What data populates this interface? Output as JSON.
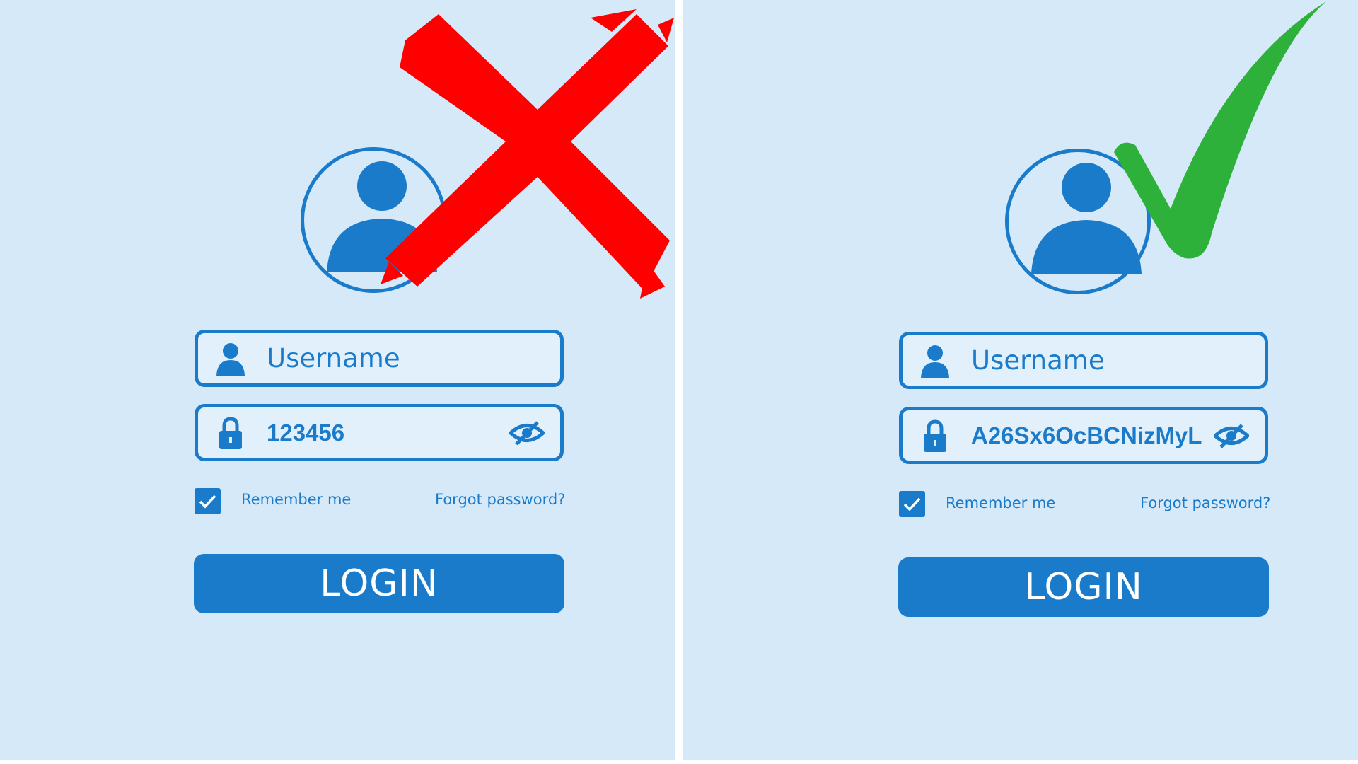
{
  "colors": {
    "background": "#d6e9f8",
    "accent": "#1a7bcb",
    "cross_mark": "#ff0000",
    "check_mark": "#2eb13a"
  },
  "left_panel": {
    "avatar_icon": "user-avatar-icon",
    "username_placeholder": "Username",
    "password_value": "123456",
    "remember_label": "Remember me",
    "remember_checked": true,
    "forgot_link": "Forgot password?",
    "login_label": "LOGIN",
    "verdict_icon": "red-cross-mark"
  },
  "right_panel": {
    "avatar_icon": "user-avatar-icon",
    "username_placeholder": "Username",
    "password_value": "A26Sx6OcBCNizMyL",
    "remember_label": "Remember me",
    "remember_checked": true,
    "forgot_link": "Forgot password?",
    "login_label": "LOGIN",
    "verdict_icon": "green-check-mark"
  }
}
